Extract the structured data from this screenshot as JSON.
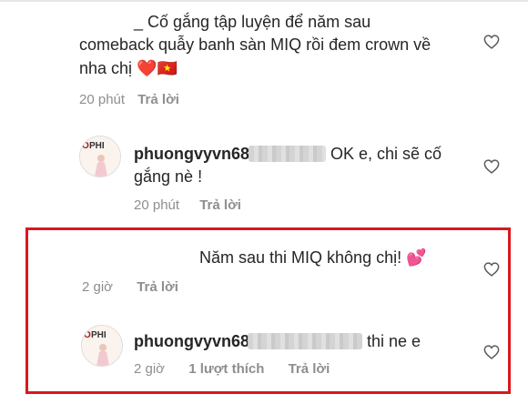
{
  "comments": [
    {
      "lines": [
        "_ Cố gắng tập luyện để năm sau",
        "comeback quẫy banh sàn MIQ rồi đem crown về",
        "nha chị"
      ],
      "emoji": "❤️🇻🇳",
      "time": "20 phút",
      "reply_label": "Trả lời"
    },
    {
      "username": "phuongvyvn68",
      "text_line1": "OK e, chi sẽ cố",
      "text_line2": "gắng nè !",
      "time": "20 phút",
      "reply_label": "Trả lời"
    },
    {
      "text": "Năm sau thi MIQ không chị!",
      "emoji": "💕",
      "time": "2 giờ",
      "reply_label": "Trả lời"
    },
    {
      "username": "phuongvyvn68",
      "text": "thi ne e",
      "time": "2 giờ",
      "likes_label": "1 lượt thích",
      "reply_label": "Trả lời"
    }
  ],
  "colors": {
    "highlight": "#d8181f",
    "meta": "#8e8e8e",
    "text": "#262626"
  },
  "icons": [
    "heart-outline-icon",
    "avatar-image"
  ]
}
